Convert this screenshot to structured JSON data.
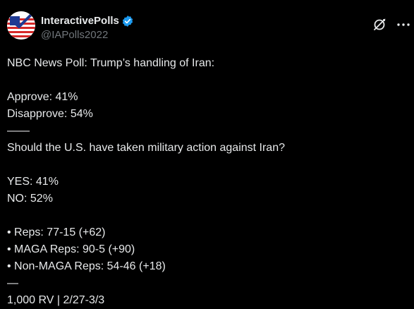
{
  "author": {
    "display_name": "InteractivePolls",
    "handle": "@IAPolls2022",
    "verified_icon": "verified-badge-icon",
    "avatar_icon": "us-flag-checkmark-logo",
    "colors": {
      "verified": "#1d9bf0",
      "handle": "#71767b",
      "text": "#e7e9ea",
      "background": "#000000"
    }
  },
  "actions": {
    "grok_icon": "grok-icon",
    "more_icon": "more-dots-icon"
  },
  "post": {
    "title": "NBC News Poll: Trump’s handling of Iran:",
    "approve": "Approve: 41%",
    "disapprove": "Disapprove: 54%",
    "divider1": "——",
    "question": "Should the U.S. have taken military action against Iran?",
    "yes": "YES: 41%",
    "no": "NO: 52%",
    "reps": "• Reps: 77-15 (+62)",
    "maga_reps": "• MAGA Reps: 90-5 (+90)",
    "non_maga_reps": "• Non-MAGA Reps: 54-46 (+18)",
    "divider2": "—",
    "footer": "1,000 RV | 2/27-3/3"
  }
}
